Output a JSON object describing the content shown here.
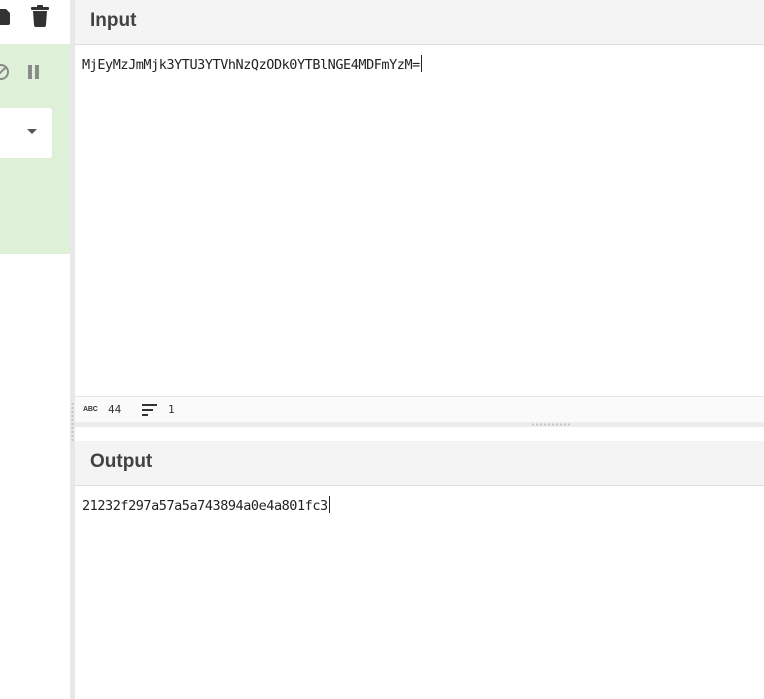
{
  "input": {
    "title": "Input",
    "text": "MjEyMzJmMjk3YTU3YTVhNzQzODk0YTBlNGE4MDFmYzM=",
    "status": {
      "length": "44",
      "lines": "1"
    }
  },
  "output": {
    "title": "Output",
    "text": "21232f297a57a5a743894a0e4a801fc3"
  },
  "icons": {
    "save": "save-icon",
    "delete": "trash-icon",
    "disable": "disable-icon",
    "breakpoint": "pause-icon",
    "dropdown": "caret-down-icon",
    "length": "abc-icon",
    "lines": "lines-icon"
  },
  "colors": {
    "recipe_op_bg": "#dff0d8",
    "header_bg": "#f4f4f4",
    "text": "#222222"
  }
}
